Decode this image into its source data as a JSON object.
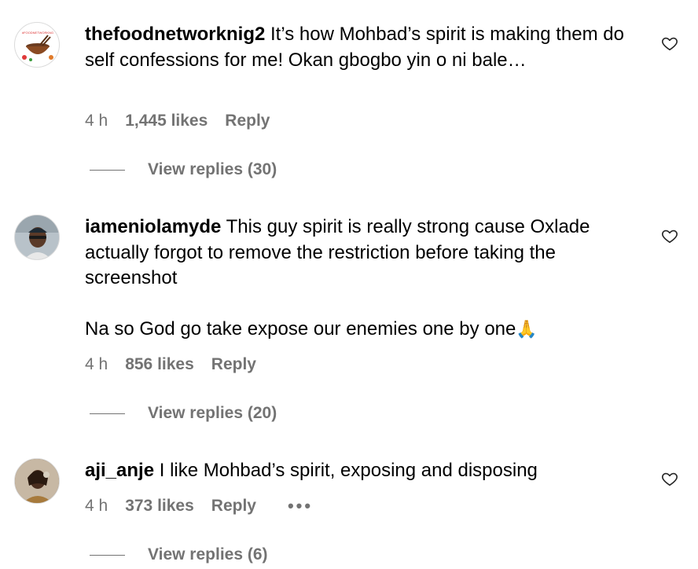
{
  "comments": [
    {
      "username": "thefoodnetworknig2",
      "text": " It’s how Mohbad’s spirit is making them do self confessions for me! Okan gbogbo yin o ni bale…",
      "time": "4 h",
      "likes": "1,445 likes",
      "reply": "Reply",
      "view_replies": "View replies (30)",
      "avatar": "bowl-logo-avatar"
    },
    {
      "username": "iameniolamyde",
      "text": " This guy spirit is really strong cause Oxlade actually forgot to remove the restriction before taking the screenshot\n\nNa so God go take expose our enemies one by one",
      "emoji": "🙏",
      "time": "4 h",
      "likes": "856 likes",
      "reply": "Reply",
      "view_replies": "View replies (20)",
      "avatar": "man-with-cap-avatar"
    },
    {
      "username": "aji_anje",
      "text": " I like Mohbad’s spirit, exposing and disposing",
      "time": "4 h",
      "likes": "373 likes",
      "reply": "Reply",
      "more": "•••",
      "view_replies": "View replies (6)",
      "avatar": "woman-photo-avatar"
    }
  ],
  "colors": {
    "secondary_text": "#737373",
    "primary_text": "#000000",
    "background": "#ffffff"
  }
}
